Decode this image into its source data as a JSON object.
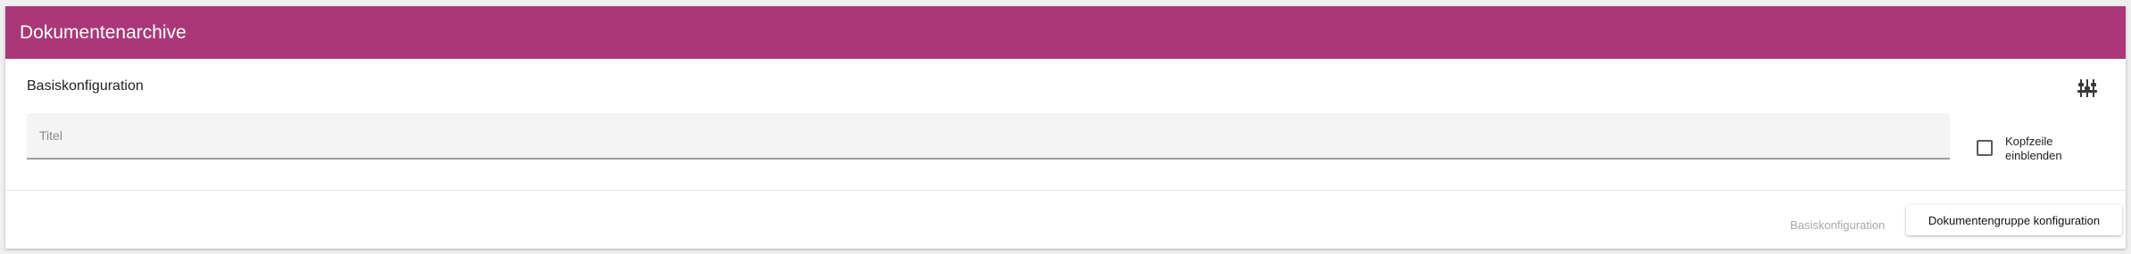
{
  "card": {
    "title": "Dokumentenarchive"
  },
  "section": {
    "title": "Basiskonfiguration",
    "settings_icon": "tune-sliders-icon"
  },
  "fields": {
    "title_placeholder": "Titel",
    "title_value": ""
  },
  "options": {
    "show_header_label": "Kopfzeile einblenden",
    "show_header_checked": false
  },
  "footer": {
    "basic_config_link": "Basiskonfiguration",
    "group_config_button": "Dokumentengruppe konfiguration"
  },
  "colors": {
    "header_bg": "#aa3878",
    "header_text": "#ffffff",
    "field_bg": "#f4f4f4",
    "muted_text": "#a8a8a8"
  }
}
